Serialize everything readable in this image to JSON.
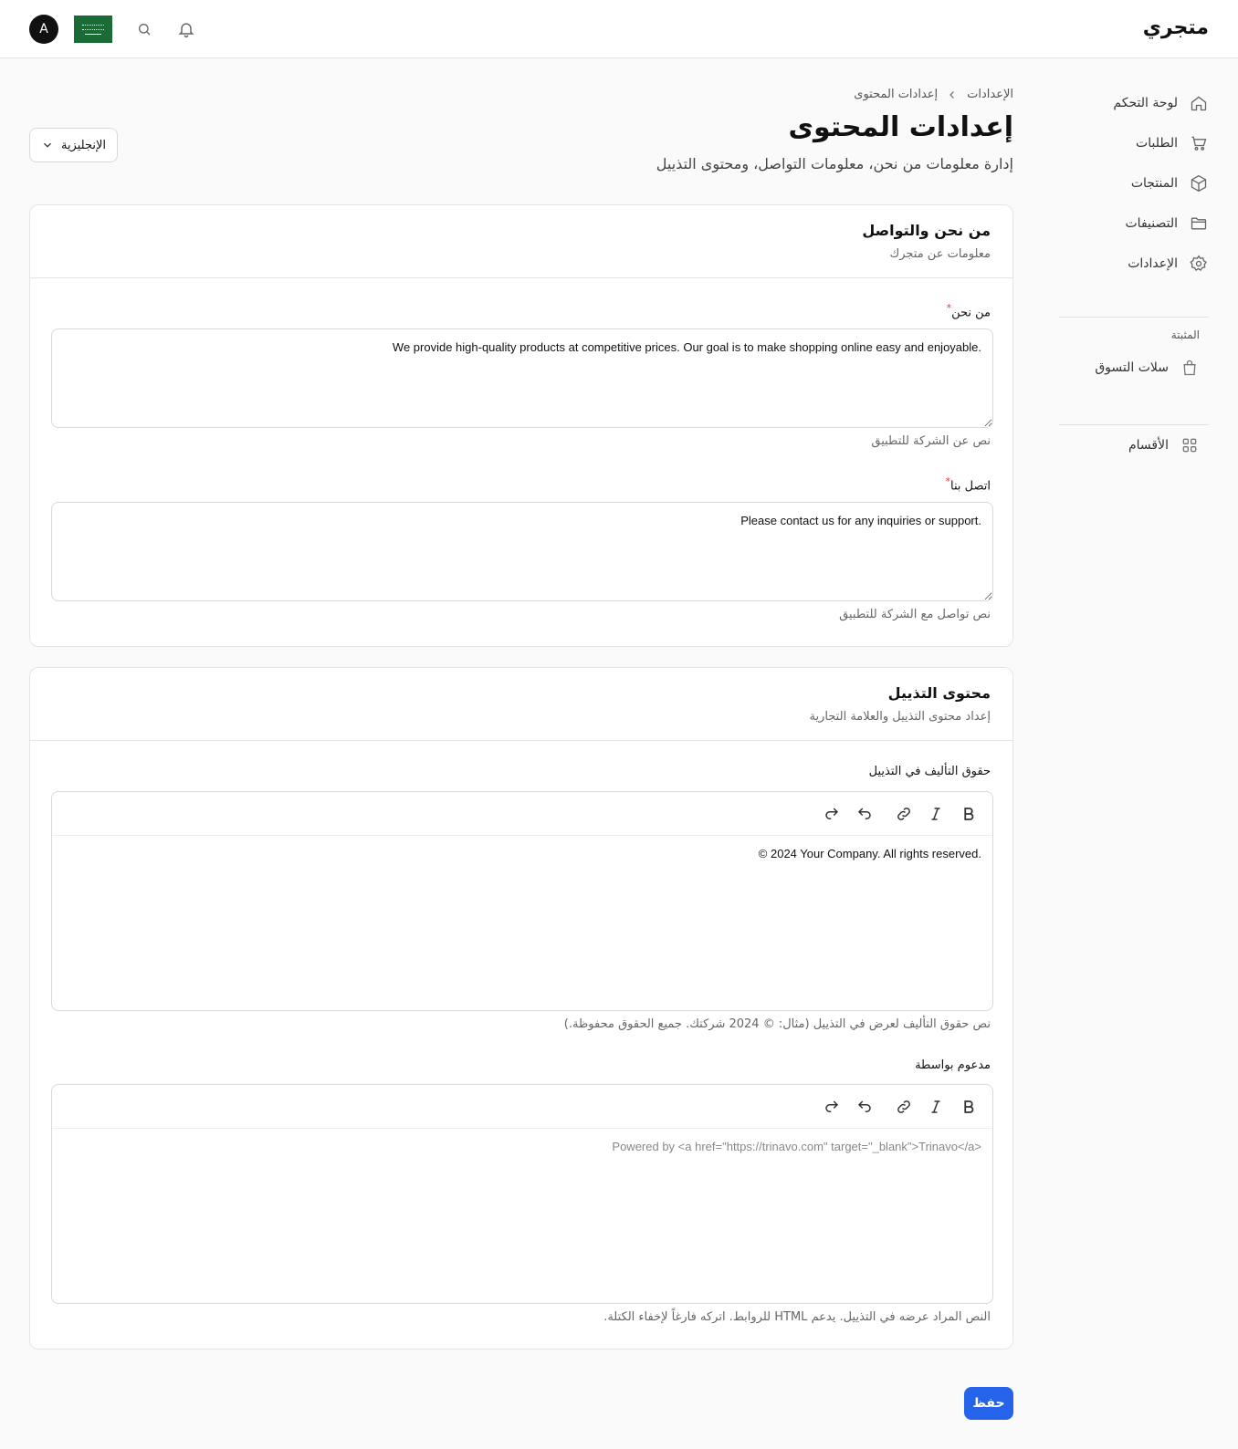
{
  "header": {
    "brand": "متجري",
    "avatar_initial": "A",
    "icons": [
      "bell-icon",
      "search-icon"
    ],
    "flag": "saudi-arabia-flag"
  },
  "sidebar": {
    "items": [
      {
        "label": "لوحة التحكم",
        "icon": "home-icon"
      },
      {
        "label": "الطلبات",
        "icon": "cart-icon"
      },
      {
        "label": "المنتجات",
        "icon": "box-icon"
      },
      {
        "label": "التصنيفات",
        "icon": "folder-icon"
      },
      {
        "label": "الإعدادات",
        "icon": "gear-icon"
      }
    ],
    "section_label": "المثبتة",
    "pinned": [
      {
        "label": "سلات التسوق",
        "icon": "shopping-bag-icon"
      }
    ],
    "extra": [
      {
        "label": "الأقسام",
        "icon": "grid-icon"
      }
    ]
  },
  "page": {
    "breadcrumb": [
      "الإعدادات",
      "إعدادات المحتوى"
    ],
    "title": "إعدادات المحتوى",
    "subtitle": "إدارة معلومات من نحن، معلومات التواصل، ومحتوى التذييل",
    "language": "الإنجليزية"
  },
  "about_card": {
    "title": "من نحن والتواصل",
    "description": "معلومات عن متجرك",
    "about_label": "من نحن",
    "about_value": "We provide high-quality products at competitive prices. Our goal is to make shopping online easy and enjoyable.",
    "about_hint": "نص عن الشركة للتطبيق",
    "contact_label": "اتصل بنا",
    "contact_value": "Please contact us for any inquiries or support.",
    "contact_hint": "نص تواصل مع الشركة للتطبيق"
  },
  "footer_card": {
    "title": "محتوى التذييل",
    "description": "إعداد محتوى التذييل والعلامة التجارية",
    "copyright_label": "حقوق التأليف في التذييل",
    "copyright_value": "© 2024 Your Company. All rights reserved.",
    "copyright_hint": "نص حقوق التأليف لعرض في التذييل (مثال: © 2024 شركتك. جميع الحقوق محفوظة.)",
    "powered_label": "مدعوم بواسطة",
    "powered_placeholder": "Powered by <a href=\"https://trinavo.com\" target=\"_blank\">Trinavo</a>",
    "powered_hint": "النص المراد عرضه في التذييل. يدعم HTML للروابط. اتركه فارغاً لإخفاء الكتلة.",
    "toolbar": [
      "bold-icon",
      "italic-icon",
      "link-icon",
      "undo-icon",
      "redo-icon"
    ]
  },
  "actions": {
    "save_label": "حفظ"
  },
  "colors": {
    "accent": "#2563eb",
    "required": "#e53935"
  }
}
